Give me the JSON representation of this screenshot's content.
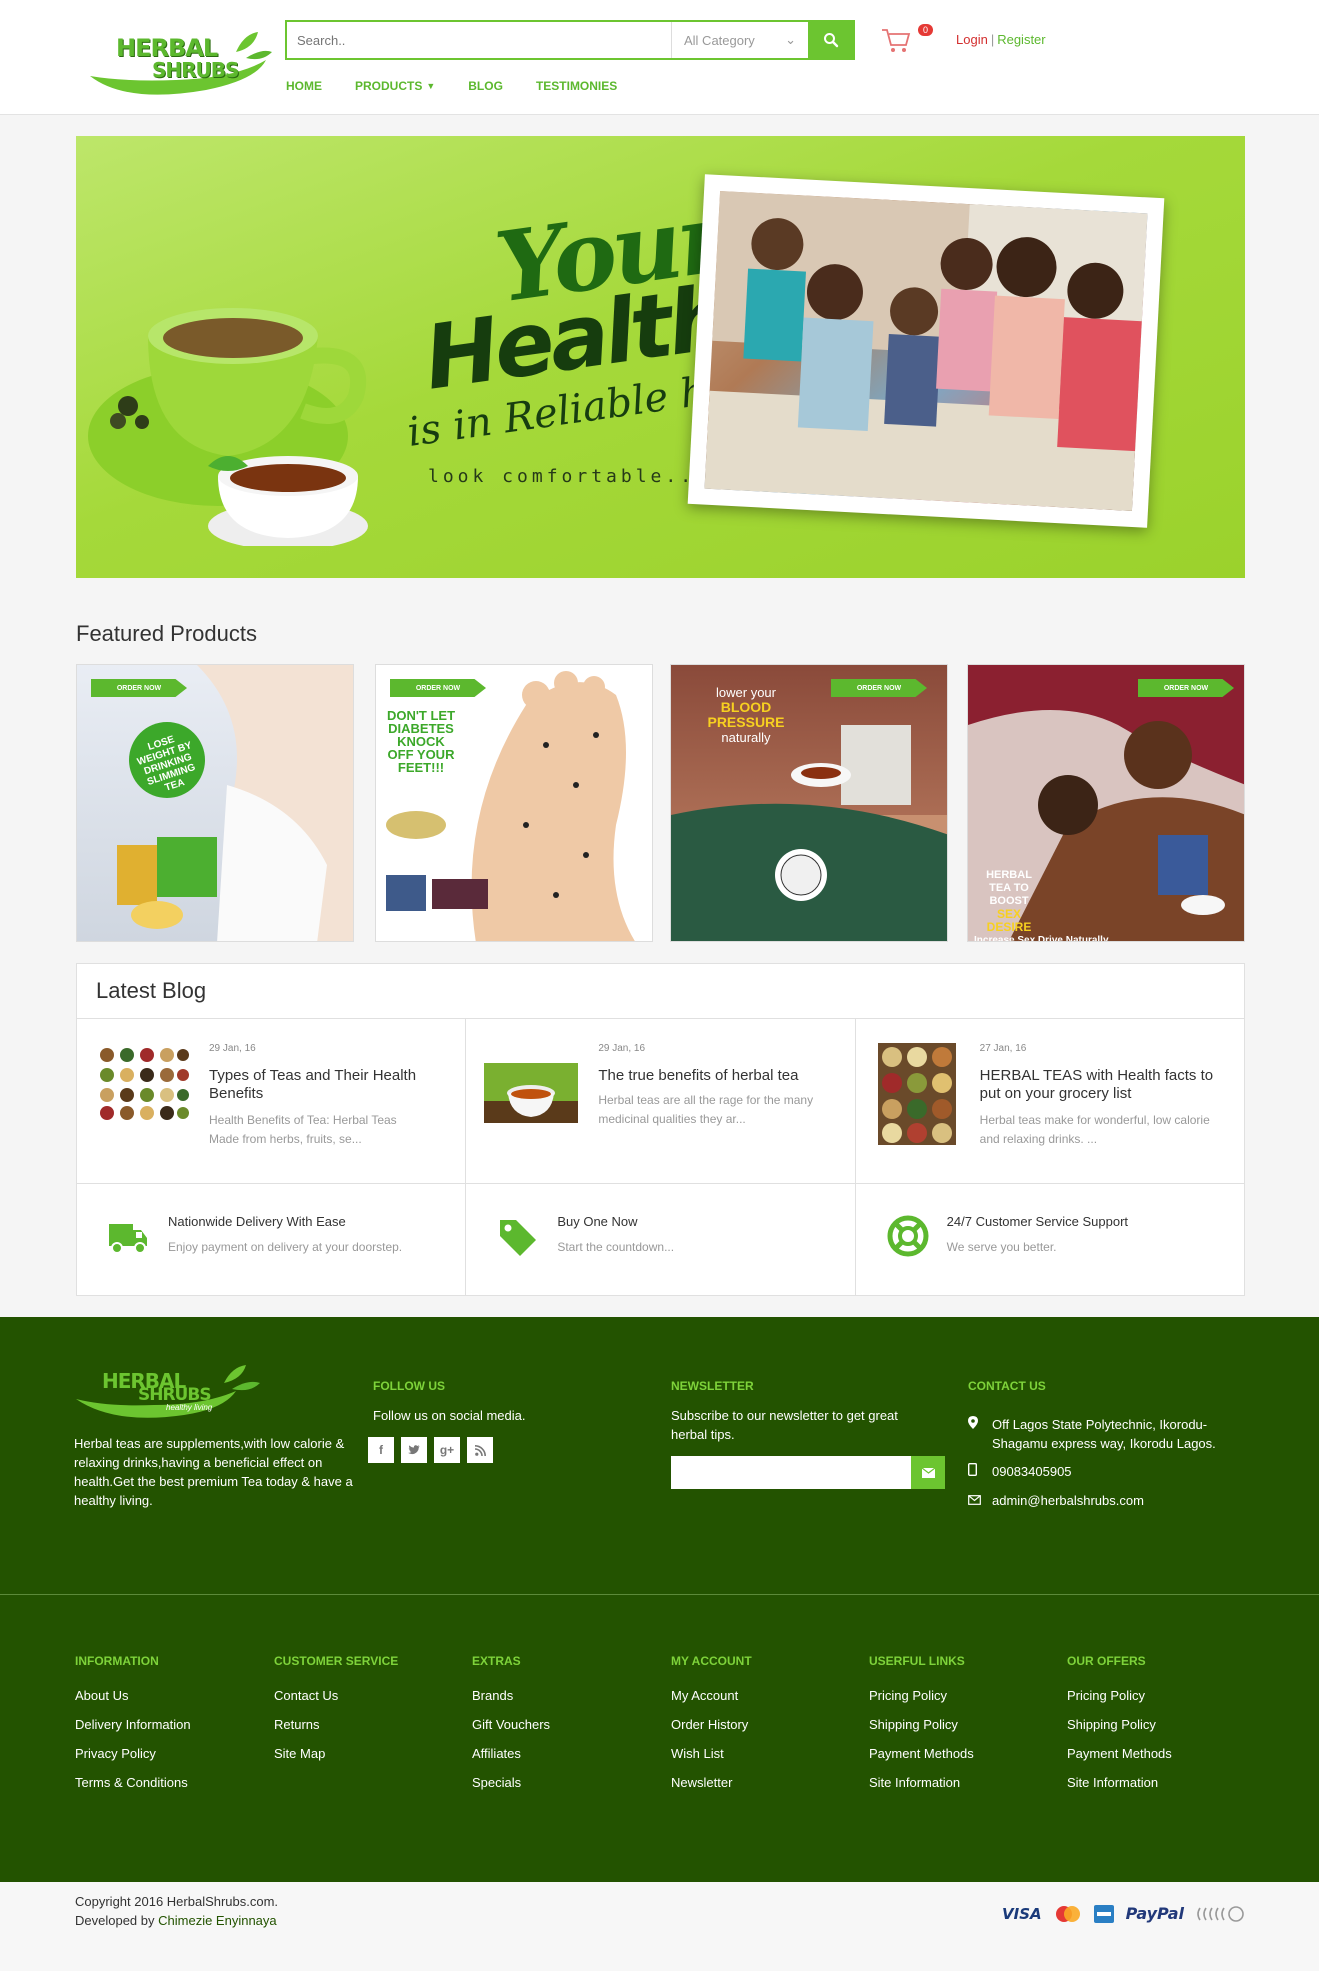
{
  "header": {
    "logo_line1": "HERBAL",
    "logo_line2": "SHRUBS",
    "search_placeholder": "Search..",
    "category_selected": "All Category",
    "cart_count": "0",
    "login": "Login",
    "register": "Register",
    "nav": [
      "HOME",
      "PRODUCTS",
      "BLOG",
      "TESTIMONIES"
    ]
  },
  "banner": {
    "your": "Your",
    "health": "Health",
    "reliable": "is in Reliable hand",
    "tagline": "look comfortable..."
  },
  "featured": {
    "title": "Featured Products",
    "order_label": "ORDER NOW",
    "items": [
      {
        "text": "LOSE WEIGHT BY DRINKING SLIMMING TEA"
      },
      {
        "text": "DON'T LET DIABETES KNOCK OFF YOUR FEET!!!"
      },
      {
        "text1": "lower your",
        "text2": "BLOOD PRESSURE",
        "text3": "naturally"
      },
      {
        "text1": "HERBAL TEA TO BOOST",
        "text2": "SEX DESIRE",
        "text3": "Increase Sex Drive Naturally"
      }
    ]
  },
  "blog": {
    "title": "Latest Blog",
    "posts": [
      {
        "date": "29 Jan, 16",
        "title": "Types of Teas and Their Health Benefits",
        "excerpt": "Health Benefits of Tea: Herbal Teas Made from herbs, fruits, se..."
      },
      {
        "date": "29 Jan, 16",
        "title": "The true benefits of herbal tea",
        "excerpt": "Herbal teas are all the rage for the many medicinal qualities they ar..."
      },
      {
        "date": "27 Jan, 16",
        "title": "HERBAL TEAS with Health facts to put on your grocery list",
        "excerpt": "Herbal teas make for wonderful, low calorie and relaxing drinks. ..."
      }
    ],
    "features": [
      {
        "icon": "truck-icon",
        "title": "Nationwide Delivery With Ease",
        "desc": "Enjoy payment on delivery at your doorstep."
      },
      {
        "icon": "tag-icon",
        "title": "Buy One Now",
        "desc": "Start the countdown..."
      },
      {
        "icon": "lifebuoy-icon",
        "title": "24/7 Customer Service Support",
        "desc": "We serve you better."
      }
    ]
  },
  "footer": {
    "logo_line1": "HERBAL",
    "logo_line2": "SHRUBS",
    "logo_slogan": "healthy living",
    "about": "Herbal teas are supplements,with low calorie & relaxing drinks,having a beneficial effect on health.Get the best premium Tea today & have a healthy living.",
    "follow_title": "FOLLOW US",
    "follow_text": "Follow us on social media.",
    "newsletter_title": "NEWSLETTER",
    "newsletter_text": "Subscribe to our newsletter to get great herbal tips.",
    "contact_title": "CONTACT US",
    "address": "Off Lagos State Polytechnic, Ikorodu-Shagamu express way, Ikorodu Lagos.",
    "phone": "09083405905",
    "email": "admin@herbalshrubs.com",
    "columns": [
      {
        "title": "INFORMATION",
        "links": [
          "About Us",
          "Delivery Information",
          "Privacy Policy",
          "Terms & Conditions"
        ]
      },
      {
        "title": "CUSTOMER SERVICE",
        "links": [
          "Contact Us",
          "Returns",
          "Site Map"
        ]
      },
      {
        "title": "EXTRAS",
        "links": [
          "Brands",
          "Gift Vouchers",
          "Affiliates",
          "Specials"
        ]
      },
      {
        "title": "MY ACCOUNT",
        "links": [
          "My Account",
          "Order History",
          "Wish List",
          "Newsletter"
        ]
      },
      {
        "title": "USERFUL LINKS",
        "links": [
          "Pricing Policy",
          "Shipping Policy",
          "Payment Methods",
          "Site Information"
        ]
      },
      {
        "title": "OUR OFFERS",
        "links": [
          "Pricing Policy",
          "Shipping Policy",
          "Payment Methods",
          "Site Information"
        ]
      }
    ]
  },
  "bottom": {
    "copyright": "Copyright 2016 HerbalShrubs.com.",
    "developed_by": "Developed by",
    "developer": "Chimezie Enyinnaya",
    "visa": "VISA",
    "paypal": "PayPal"
  },
  "colors": {
    "accent": "#6cc530",
    "footer_bg": "#235300",
    "link_red": "#d32f2f"
  }
}
